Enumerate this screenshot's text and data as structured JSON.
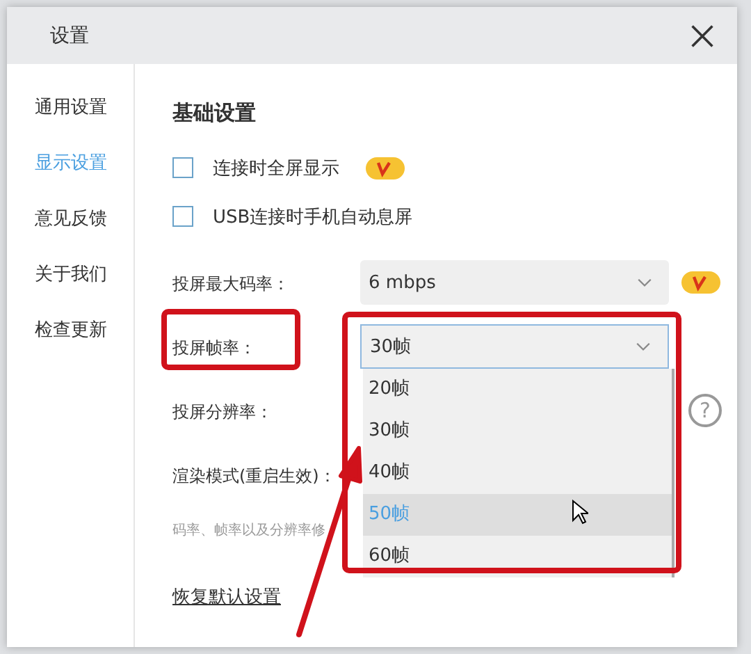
{
  "dialog": {
    "title": "设置"
  },
  "sidebar": {
    "items": [
      {
        "label": "通用设置",
        "selected": false
      },
      {
        "label": "显示设置",
        "selected": true
      },
      {
        "label": "意见反馈",
        "selected": false
      },
      {
        "label": "关于我们",
        "selected": false
      },
      {
        "label": "检查更新",
        "selected": false
      }
    ]
  },
  "section_title": "基础设置",
  "checkboxes": [
    {
      "label": "连接时全屏显示",
      "checked": false,
      "vip": true
    },
    {
      "label": "USB连接时手机自动息屏",
      "checked": false,
      "vip": false
    }
  ],
  "rows": [
    {
      "kind": "select",
      "label": "投屏最大码率：",
      "value": "6 mbps",
      "vip": true,
      "highlighted": false
    },
    {
      "kind": "select",
      "label": "投屏帧率：",
      "value": "30帧",
      "open": true,
      "highlighted": true,
      "options": [
        {
          "label": "20帧",
          "hovered": false
        },
        {
          "label": "30帧",
          "hovered": false
        },
        {
          "label": "40帧",
          "hovered": false
        },
        {
          "label": "50帧",
          "hovered": true
        },
        {
          "label": "60帧",
          "hovered": false
        }
      ]
    },
    {
      "kind": "help",
      "label": "投屏分辨率：",
      "help": "?",
      "highlighted": false
    },
    {
      "kind": "plain",
      "label": "渲染模式(重启生效)：",
      "highlighted": false
    }
  ],
  "hint": "码率、帧率以及分辨率修",
  "reset_link": "恢复默认设置"
}
